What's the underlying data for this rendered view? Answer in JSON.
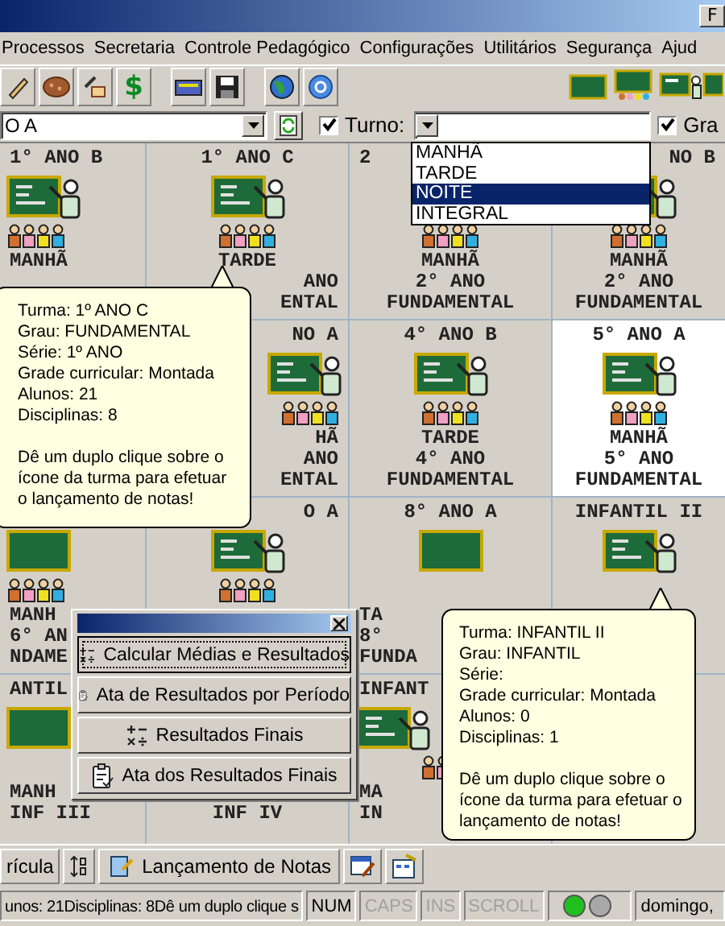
{
  "window": {
    "title_button": "F"
  },
  "menu": [
    "Processos",
    "Secretaria",
    "Controle Pedagógico",
    "Configurações",
    "Utilitários",
    "Segurança",
    "Ajud"
  ],
  "toolbar": {
    "currency_symbol": "$"
  },
  "filters": {
    "class_value": "O A",
    "shift_checkbox": {
      "label": "Turno:",
      "checked": true
    },
    "grade_checkbox": {
      "label": "Gra",
      "checked": true
    }
  },
  "shift_dropdown": {
    "options": [
      {
        "label": "MANHÃ",
        "selected": false
      },
      {
        "label": "TARDE",
        "selected": false
      },
      {
        "label": "NOITE",
        "selected": true
      },
      {
        "label": "INTEGRAL",
        "selected": false
      }
    ]
  },
  "classes": [
    {
      "title": "1° ANO B",
      "kind": "teacher",
      "students": true,
      "shift": "MANHÃ",
      "selected": false
    },
    {
      "title": "1° ANO C",
      "kind": "teacher",
      "students": true,
      "shift": "TARDE",
      "series": "ANO",
      "grade": "ENTAL",
      "selected": false
    },
    {
      "title": "2",
      "kind": "empty",
      "students": true,
      "shift": "MANHÃ",
      "series": "2° ANO",
      "grade": "FUNDAMENTAL",
      "selected": false
    },
    {
      "title": "NO B",
      "kind": "teacher",
      "students": true,
      "shift": "MANHÃ",
      "series": "2° ANO",
      "grade": "FUNDAMENTAL",
      "selected": false
    },
    {
      "kind": "empty"
    },
    {
      "title": "NO A",
      "kind": "teacher",
      "students": true,
      "shift": "HÃ",
      "series": "ANO",
      "grade": "ENTAL",
      "selected": false
    },
    {
      "title": "4° ANO B",
      "kind": "teacher",
      "students": true,
      "shift": "TARDE",
      "series": "4° ANO",
      "grade": "FUNDAMENTAL",
      "selected": false
    },
    {
      "title": "5° ANO A",
      "kind": "teacher",
      "students": true,
      "shift": "MANHÃ",
      "series": "5° ANO",
      "grade": "FUNDAMENTAL",
      "selected": true
    },
    {
      "kind": "board",
      "students": true,
      "shift": "MANH",
      "series": "6° AN",
      "grade": "NDAME",
      "selected": false
    },
    {
      "title": "O A",
      "kind": "teacher",
      "students": true,
      "selected": false
    },
    {
      "title": "8° ANO A",
      "kind": "board",
      "students": false,
      "shift": "TA",
      "series": "8°",
      "grade": "FUNDA",
      "selected": false
    },
    {
      "title": "INFANTIL II",
      "kind": "teacher",
      "students": false,
      "selected": false
    },
    {
      "title": "ANTIL",
      "kind": "board",
      "students": false,
      "shift": "MANH",
      "series": "INF III",
      "selected": false
    },
    {
      "kind": "empty",
      "series": "INF IV",
      "selected": false
    },
    {
      "title": "INFANT",
      "kind": "teacher",
      "students": true,
      "shift": "MA",
      "series": "IN",
      "selected": false
    },
    {
      "kind": "empty",
      "selected": false
    }
  ],
  "tooltips": [
    {
      "lines": [
        "Turma: 1º ANO C",
        "Grau: FUNDAMENTAL",
        "Série: 1º ANO",
        "Grade curricular: Montada",
        "Alunos: 21",
        "Disciplinas: 8"
      ],
      "hint": "Dê um duplo clique sobre o ícone da turma para efetuar o lançamento de notas!"
    },
    {
      "lines": [
        "Turma: INFANTIL II",
        "Grau: INFANTIL",
        "Série:",
        "Grade curricular: Montada",
        "Alunos: 0",
        "Disciplinas: 1"
      ],
      "hint": "Dê um duplo clique sobre o ícone da turma para efetuar o lançamento de notas!"
    }
  ],
  "results_menu": {
    "items": [
      {
        "label": "Calcular Médias e Resultados",
        "kind": "calc",
        "focused": true
      },
      {
        "label": "Ata de Resultados por Período",
        "kind": "report",
        "focused": false
      },
      {
        "label": "Resultados Finais",
        "kind": "calc",
        "focused": false
      },
      {
        "label": "Ata dos Resultados Finais",
        "kind": "report",
        "focused": false
      }
    ]
  },
  "bottom_toolbar": {
    "enrollment_label": "rícula",
    "grades_label": "Lançamento de Notas"
  },
  "status_bar": {
    "message": "unos: 21Disciplinas: 8Dê um duplo clique s",
    "indicators": [
      {
        "label": "NUM",
        "enabled": true
      },
      {
        "label": "CAPS",
        "enabled": false
      },
      {
        "label": "INS",
        "enabled": false
      },
      {
        "label": "SCROLL",
        "enabled": false
      }
    ],
    "lights": [
      {
        "on": true
      },
      {
        "on": false
      }
    ],
    "date": "domingo,"
  }
}
